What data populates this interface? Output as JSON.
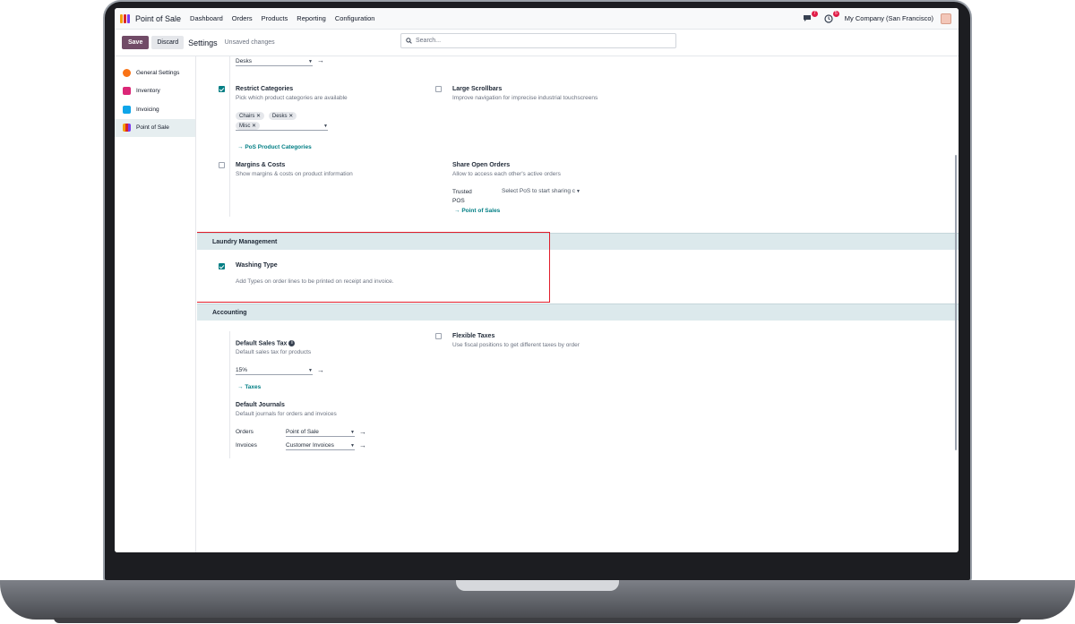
{
  "navbar": {
    "app_name": "Point of Sale",
    "menu": [
      "Dashboard",
      "Orders",
      "Products",
      "Reporting",
      "Configuration"
    ],
    "messages_count": "7",
    "activities_count": "5",
    "company": "My Company (San Francisco)"
  },
  "control": {
    "save_label": "Save",
    "discard_label": "Discard",
    "title": "Settings",
    "status": "Unsaved changes",
    "search_placeholder": "Search..."
  },
  "sidebar": {
    "items": [
      {
        "label": "General Settings",
        "color": "#f97316"
      },
      {
        "label": "Inventory",
        "color": "#db2777"
      },
      {
        "label": "Invoicing",
        "color": "#0ea5e9"
      },
      {
        "label": "Point of Sale",
        "color": "#b45309",
        "active": true
      }
    ]
  },
  "products": {
    "desks_select": "Desks",
    "restrict_categories": {
      "title": "Restrict Categories",
      "desc": "Pick which product categories are available",
      "checked": true,
      "tags": [
        "Chairs",
        "Desks",
        "Misc"
      ],
      "link": "PoS Product Categories"
    },
    "large_scrollbars": {
      "title": "Large Scrollbars",
      "desc": "Improve navigation for imprecise industrial touchscreens",
      "checked": false
    },
    "margins_costs": {
      "title": "Margins & Costs",
      "desc": "Show margins & costs on product information",
      "checked": false
    },
    "share_open_orders": {
      "title": "Share Open Orders",
      "desc": "Allow to access each other's active orders",
      "trusted_label_1": "Trusted",
      "trusted_label_2": "POS",
      "trusted_placeholder": "Select PoS to start sharing c",
      "link": "Point of Sales"
    }
  },
  "laundry": {
    "section_title": "Laundry Management",
    "washing_type": {
      "title": "Washing Type",
      "desc": "Add Types on order lines to be printed on receipt and invoice.",
      "checked": true
    }
  },
  "accounting": {
    "section_title": "Accounting",
    "default_sales_tax": {
      "title": "Default Sales Tax",
      "desc": "Default sales tax for products",
      "value": "15%",
      "link": "Taxes"
    },
    "flexible_taxes": {
      "title": "Flexible Taxes",
      "desc": "Use fiscal positions to get different taxes by order",
      "checked": false
    },
    "default_journals": {
      "title": "Default Journals",
      "desc": "Default journals for orders and invoices",
      "orders_label": "Orders",
      "orders_value": "Point of Sale",
      "invoices_label": "Invoices",
      "invoices_value": "Customer Invoices"
    }
  },
  "colors": {
    "brand": "#714b67",
    "accent": "#017e84",
    "highlight": "#e11d2a"
  }
}
